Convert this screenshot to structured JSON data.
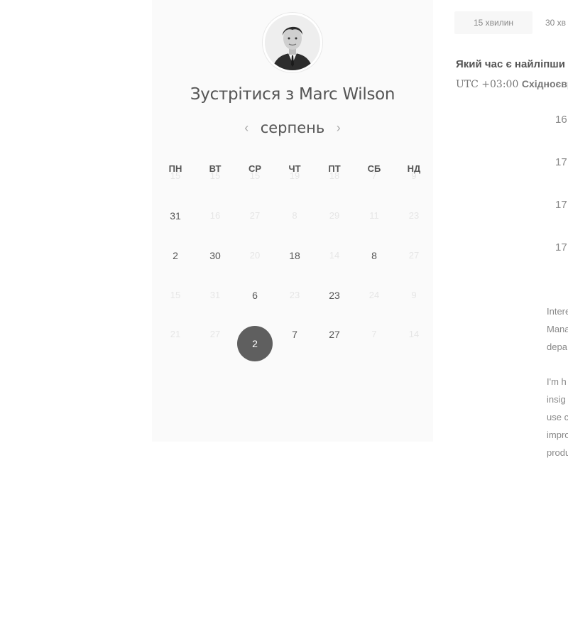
{
  "header": {
    "meet_title": "Зустрітися з Marc Wilson",
    "month": "серпень"
  },
  "weekdays": [
    "ПН",
    "ВТ",
    "СР",
    "ЧТ",
    "ПТ",
    "СБ",
    "НД"
  ],
  "calendar_rows": [
    [
      {
        "d": "15",
        "m": true
      },
      {
        "d": "15",
        "m": true
      },
      {
        "d": "15",
        "m": true
      },
      {
        "d": "19",
        "m": true
      },
      {
        "d": "18",
        "m": true
      },
      {
        "d": "7",
        "m": true
      },
      {
        "d": "9",
        "m": true
      }
    ],
    [
      {
        "d": "31",
        "m": false
      },
      {
        "d": "16",
        "m": true
      },
      {
        "d": "27",
        "m": true
      },
      {
        "d": "8",
        "m": true
      },
      {
        "d": "29",
        "m": true
      },
      {
        "d": "11",
        "m": true
      },
      {
        "d": "23",
        "m": true
      }
    ],
    [
      {
        "d": "2",
        "m": false
      },
      {
        "d": "30",
        "m": false
      },
      {
        "d": "20",
        "m": true
      },
      {
        "d": "18",
        "m": false
      },
      {
        "d": "14",
        "m": true
      },
      {
        "d": "8",
        "m": false
      },
      {
        "d": "27",
        "m": true
      }
    ],
    [
      {
        "d": "15",
        "m": true
      },
      {
        "d": "31",
        "m": true
      },
      {
        "d": "6",
        "m": false
      },
      {
        "d": "23",
        "m": true
      },
      {
        "d": "23",
        "m": false
      },
      {
        "d": "24",
        "m": true
      },
      {
        "d": "9",
        "m": true
      }
    ],
    [
      {
        "d": "21",
        "m": true
      },
      {
        "d": "27",
        "m": true
      },
      {
        "d": "2",
        "m": false,
        "selected": true
      },
      {
        "d": "7",
        "m": false
      },
      {
        "d": "27",
        "m": false
      },
      {
        "d": "7",
        "m": true
      },
      {
        "d": "14",
        "m": true
      }
    ]
  ],
  "durations": [
    "15 хвилин",
    "30 хв"
  ],
  "right": {
    "best_time_title": "Який час є найліпши",
    "tz_prefix": "UTC +03:00",
    "tz_name": "Східноєвро",
    "slots": [
      "16",
      "17",
      "17",
      "17"
    ],
    "description": [
      "Intere",
      "Mana",
      "depa",
      "",
      "I'm h",
      "insig",
      "use c",
      "impro",
      "produ"
    ]
  },
  "icons": {
    "prev": "chevron-left-icon",
    "next": "chevron-right-icon"
  },
  "colors": {
    "selected_day": "#5f5f5f",
    "panel_bg": "#fafafa"
  }
}
